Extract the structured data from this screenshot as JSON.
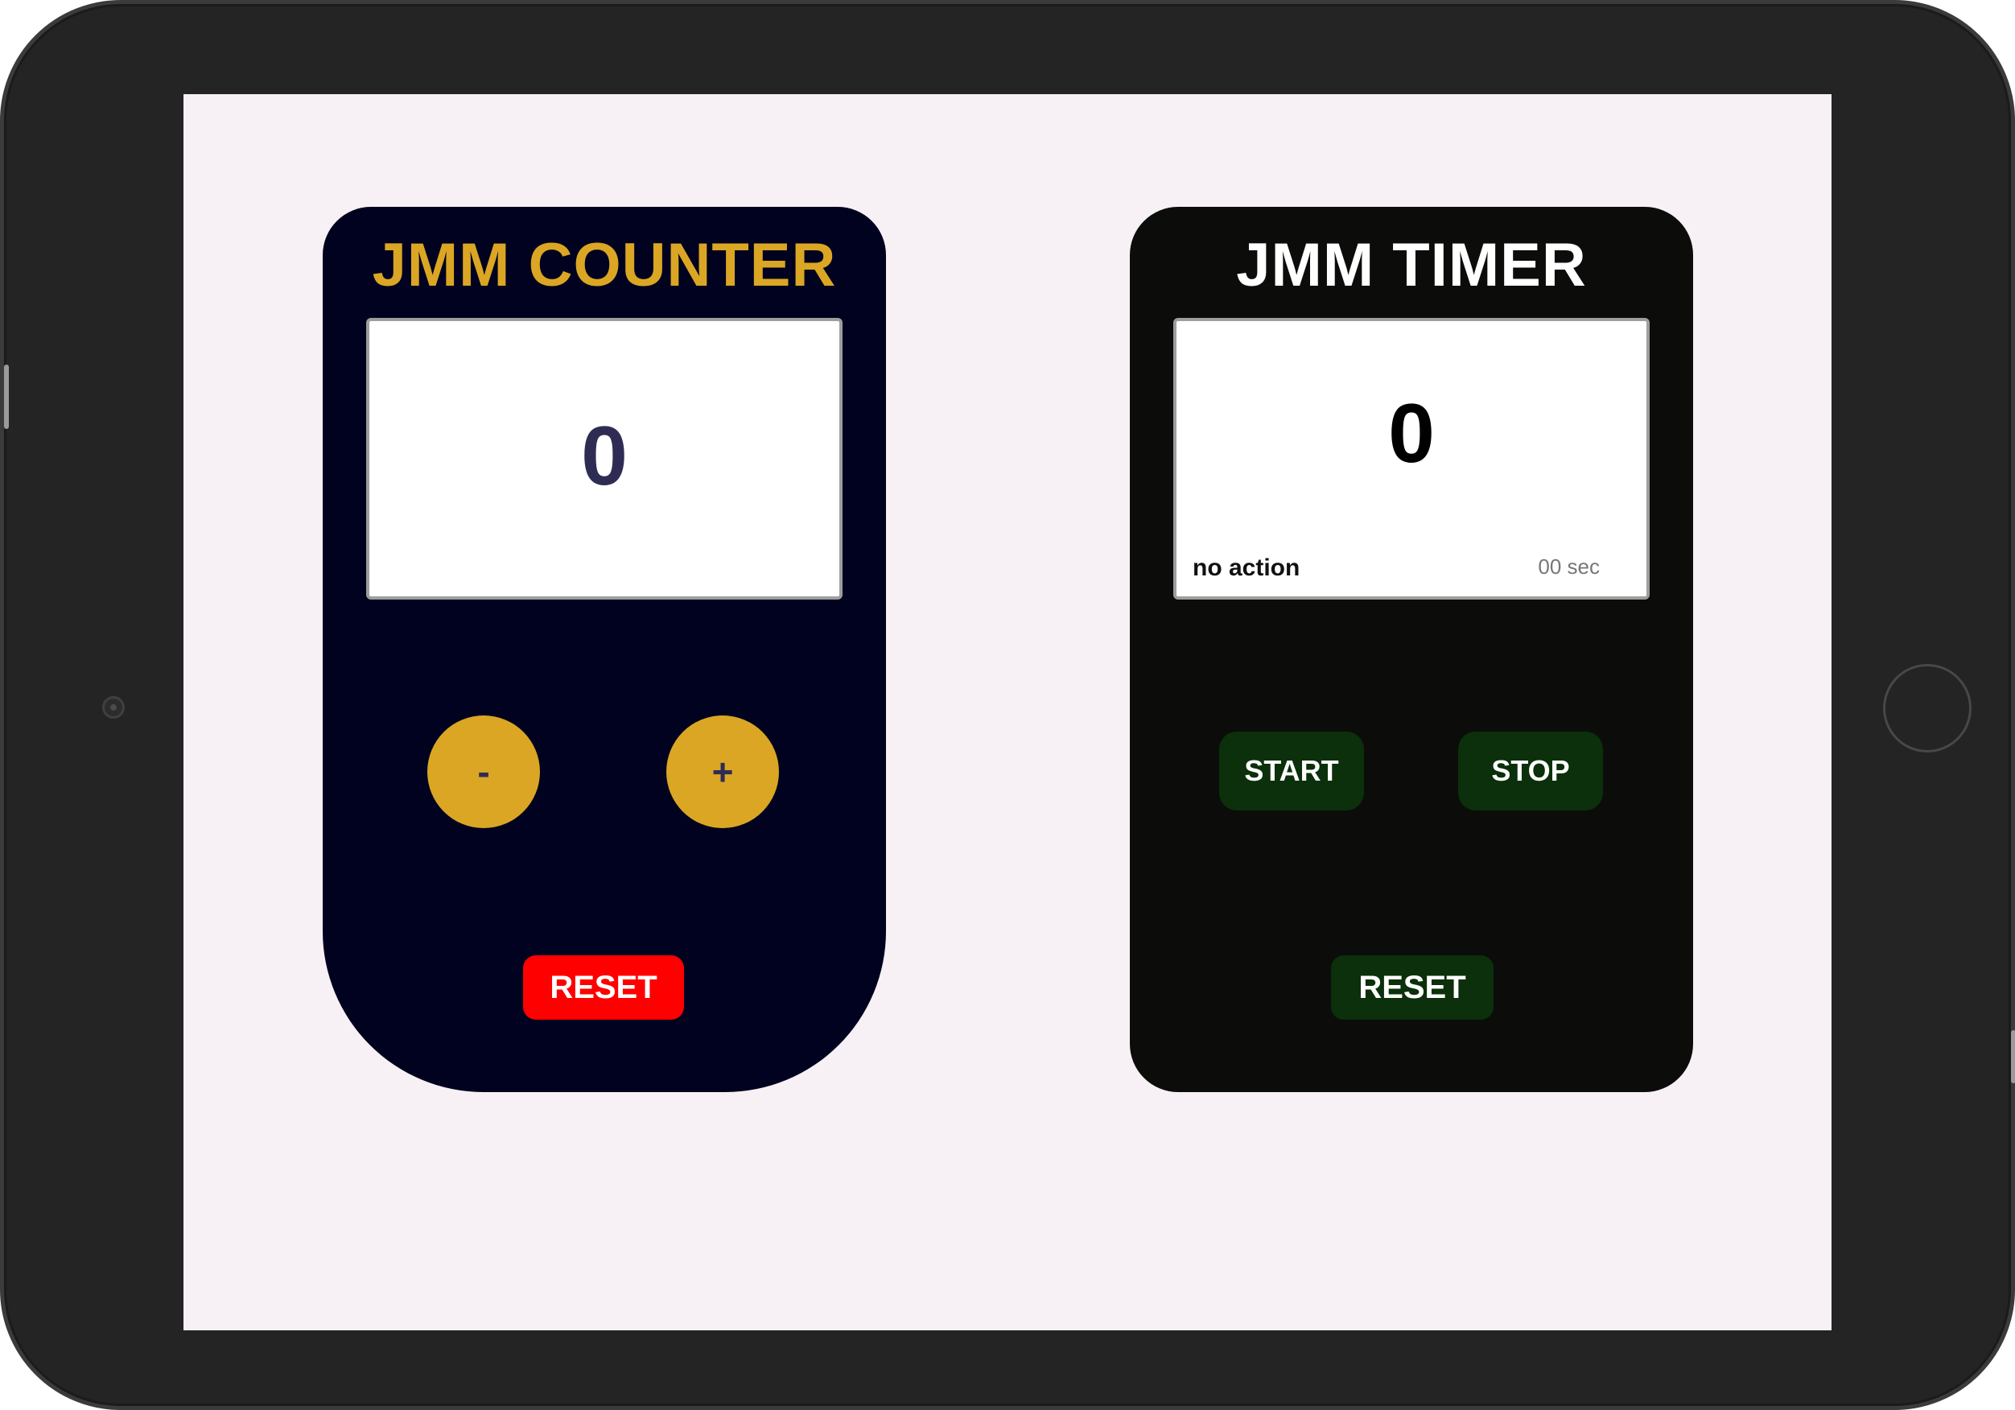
{
  "colors": {
    "bezel": "#232423",
    "screen_bg": "#f7f0f5",
    "counter_card_bg": "#01021f",
    "counter_accent": "#dba624",
    "counter_value": "#2f2c54",
    "counter_reset": "#ff0000",
    "timer_card_bg": "#0c0d0b",
    "timer_button": "#0b300b"
  },
  "counter": {
    "title": "JMM COUNTER",
    "value": "0",
    "decrement_label": "-",
    "increment_label": "+",
    "reset_label": "RESET"
  },
  "timer": {
    "title": "JMM TIMER",
    "value": "0",
    "status": "no action",
    "seconds": "00 sec",
    "start_label": "START",
    "stop_label": "STOP",
    "reset_label": "RESET"
  }
}
